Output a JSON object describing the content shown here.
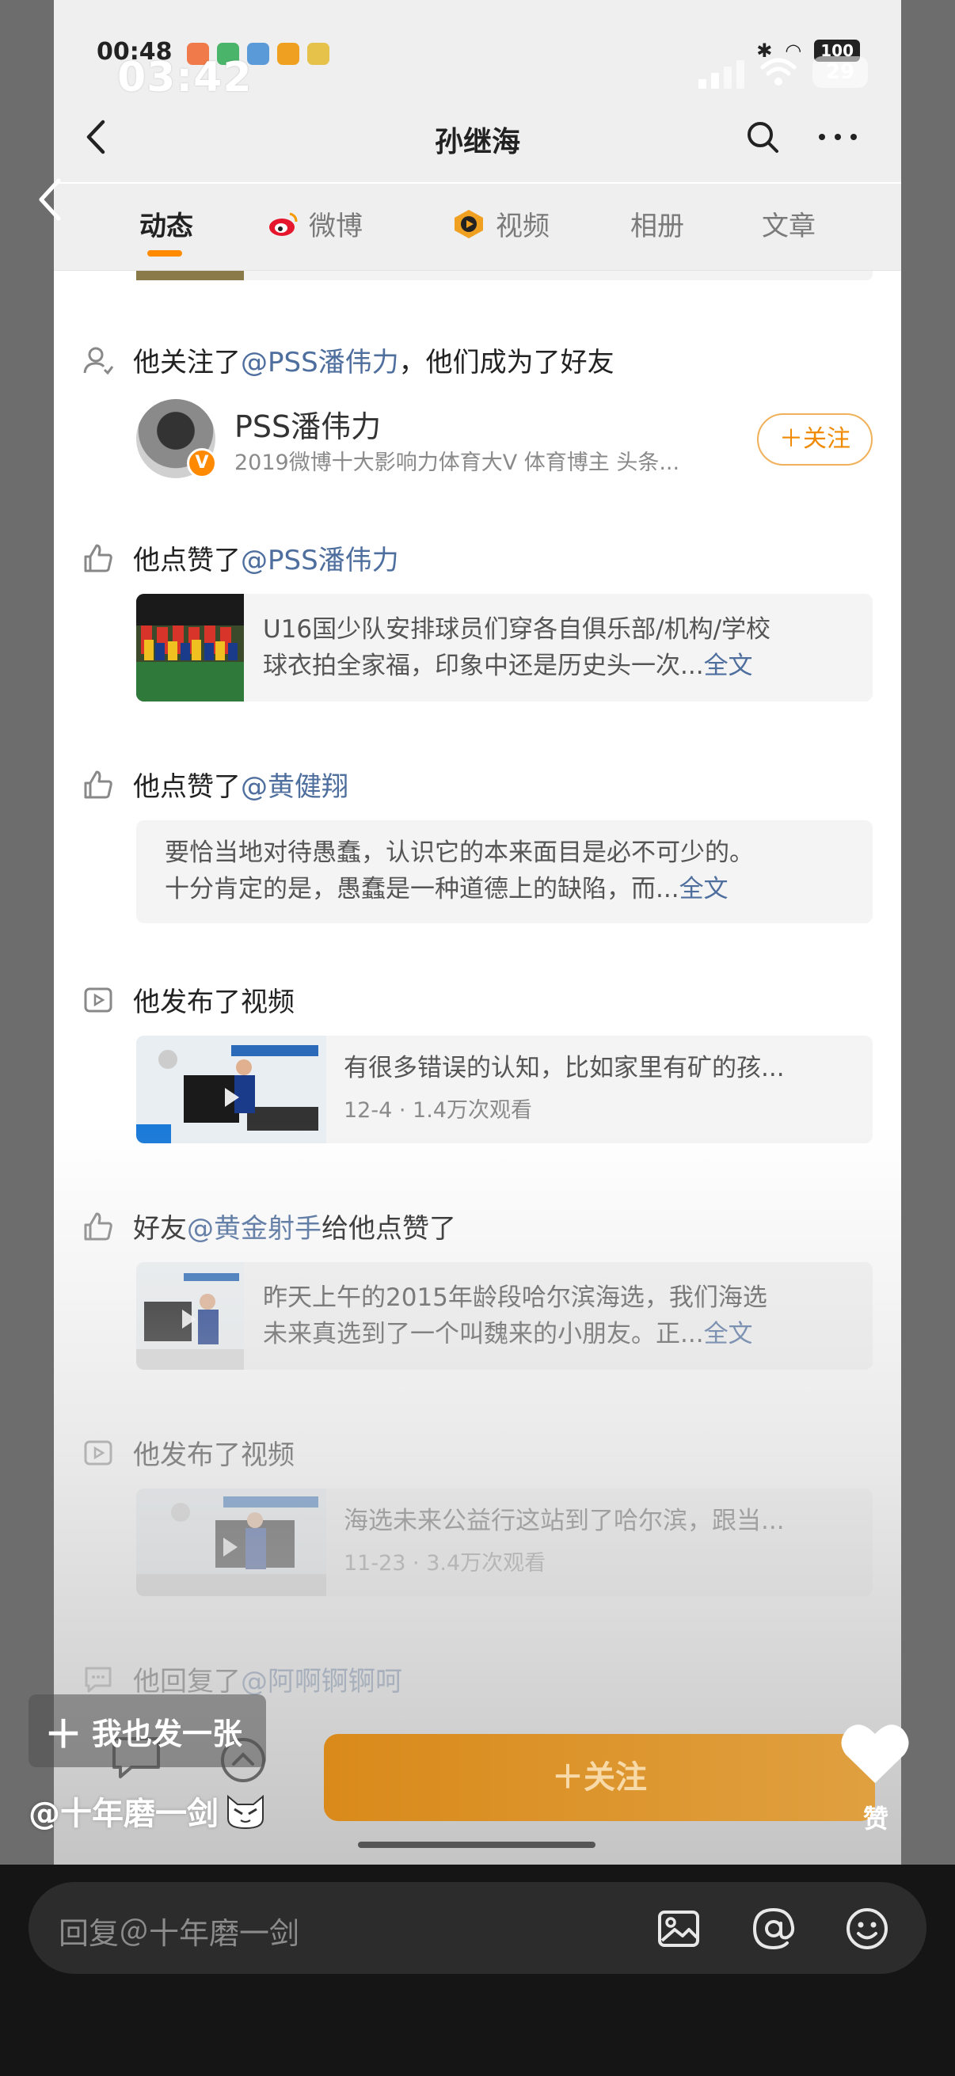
{
  "outer_status": {
    "time": "03:42",
    "battery": "29"
  },
  "status": {
    "time": "00:48",
    "battery": "100"
  },
  "nav": {
    "title": "孙继海"
  },
  "tabs": [
    {
      "label": "动态"
    },
    {
      "label": "微博"
    },
    {
      "label": "视频"
    },
    {
      "label": "相册"
    },
    {
      "label": "文章"
    }
  ],
  "feed": {
    "follow_item": {
      "prefix": "他关注了",
      "mention": "@PSS潘伟力",
      "suffix": "，他们成为了好友",
      "user_name": "PSS潘伟力",
      "user_desc": "2019微博十大影响力体育大V 体育博主 头条...",
      "follow_label": "＋关注",
      "badge": "V"
    },
    "like_item_1": {
      "prefix": "他点赞了",
      "mention": "@PSS潘伟力",
      "line1": "U16国少队安排球员们穿各自俱乐部/机构/学校",
      "line2": "球衣拍全家福，印象中还是历史头一次...",
      "more": "全文"
    },
    "like_item_2": {
      "prefix": "他点赞了",
      "mention": "@黄健翔",
      "line1": "要恰当地对待愚蠢，认识它的本来面目是必不可少的。",
      "line2": "十分肯定的是，愚蠢是一种道德上的缺陷，而...",
      "more": "全文"
    },
    "video_item_1": {
      "text": "他发布了视频",
      "title": "有很多错误的认知，比如家里有矿的孩...",
      "meta": "12-4 · 1.4万次观看"
    },
    "friend_like_item": {
      "prefix": "好友",
      "mention": "@黄金射手",
      "suffix": "给他点赞了",
      "line1": "昨天上午的2015年龄段哈尔滨海选，我们海选",
      "line2": "未来真选到了一个叫魏来的小朋友。正...",
      "more": "全文"
    },
    "video_item_2": {
      "text": "他发布了视频",
      "title": "海选未来公益行这站到了哈尔滨，跟当...",
      "meta": "11-23 · 3.4万次观看"
    },
    "reply_item": {
      "prefix": "他回复了",
      "mention": "@阿啊锕锕呵"
    }
  },
  "overlay": {
    "fab_label": "我也发一张",
    "author": "@十年磨一剑",
    "follow_button": "＋关注",
    "like_label": "赞"
  },
  "reply_bar": {
    "placeholder": "回复＠十年磨一剑"
  },
  "colors": {
    "accent": "#ff8a00",
    "mention": "#4e6e9e"
  }
}
